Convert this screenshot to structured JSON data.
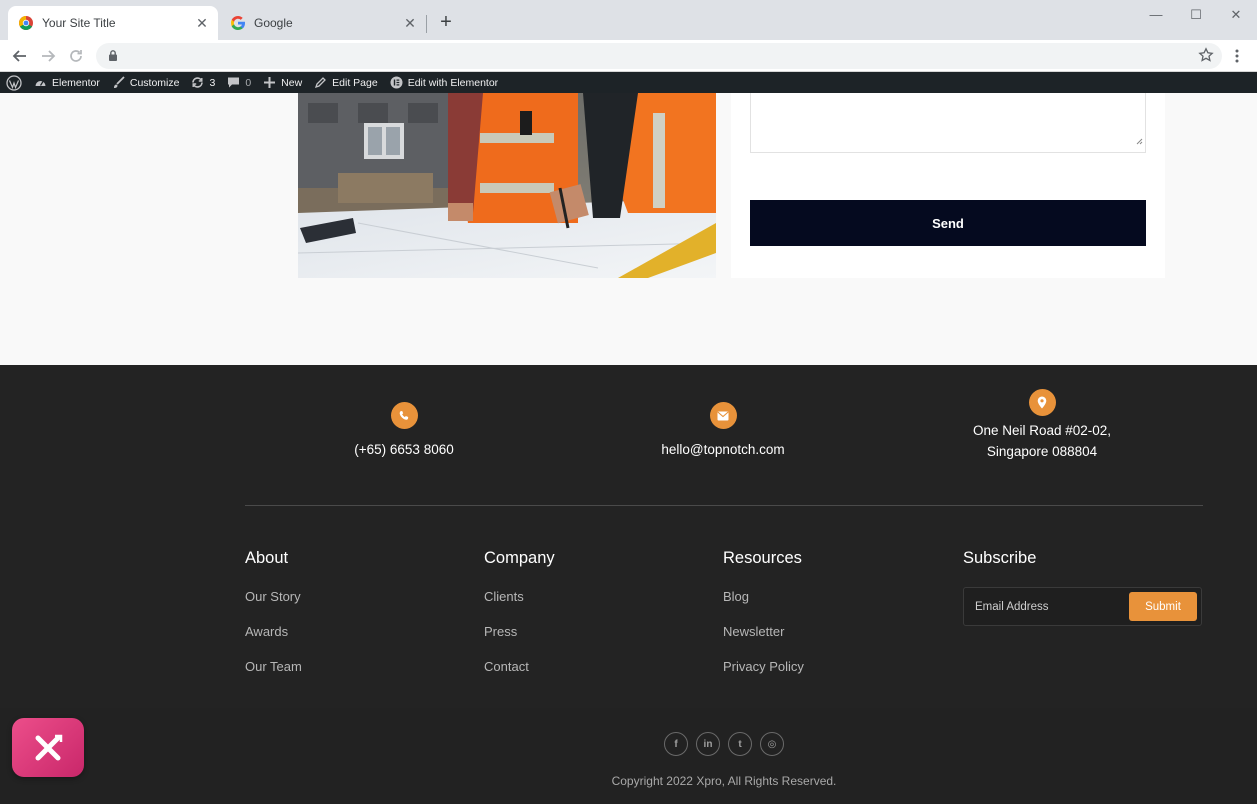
{
  "browser": {
    "tabs": [
      {
        "title": "Your Site Title",
        "active": true
      },
      {
        "title": "Google",
        "active": false
      }
    ],
    "window_controls": {
      "minimize": "—",
      "maximize": "☐",
      "close": "✕"
    }
  },
  "admin_bar": {
    "items": [
      "Elementor",
      "Customize",
      "3",
      "0",
      "New",
      "Edit Page",
      "Edit with Elementor"
    ]
  },
  "contact_form": {
    "send_label": "Send"
  },
  "footer": {
    "contacts": [
      {
        "icon": "phone-icon",
        "text": "(+65) 6653 8060"
      },
      {
        "icon": "envelope-icon",
        "text": "hello@topnotch.com"
      },
      {
        "icon": "map-pin-icon",
        "line1": "One Neil Road #02-02,",
        "line2": "Singapore 088804"
      }
    ],
    "columns": [
      {
        "heading": "About",
        "links": [
          "Our Story",
          "Awards",
          "Our Team"
        ]
      },
      {
        "heading": "Company",
        "links": [
          "Clients",
          "Press",
          "Contact"
        ]
      },
      {
        "heading": "Resources",
        "links": [
          "Blog",
          "Newsletter",
          "Privacy Policy"
        ]
      }
    ],
    "subscribe": {
      "heading": "Subscribe",
      "placeholder": "Email Address",
      "button": "Submit"
    },
    "socials": [
      "facebook-icon",
      "linkedin-icon",
      "twitter-icon",
      "instagram-icon"
    ],
    "social_glyphs": [
      "f",
      "in",
      "t",
      "◎"
    ],
    "copyright": "Copyright 2022 Xpro, All Rights Reserved."
  },
  "colors": {
    "accent": "#e8923a",
    "footer_bg": "#232323",
    "send_bg": "#050a1f",
    "badge": "#e0407e"
  }
}
